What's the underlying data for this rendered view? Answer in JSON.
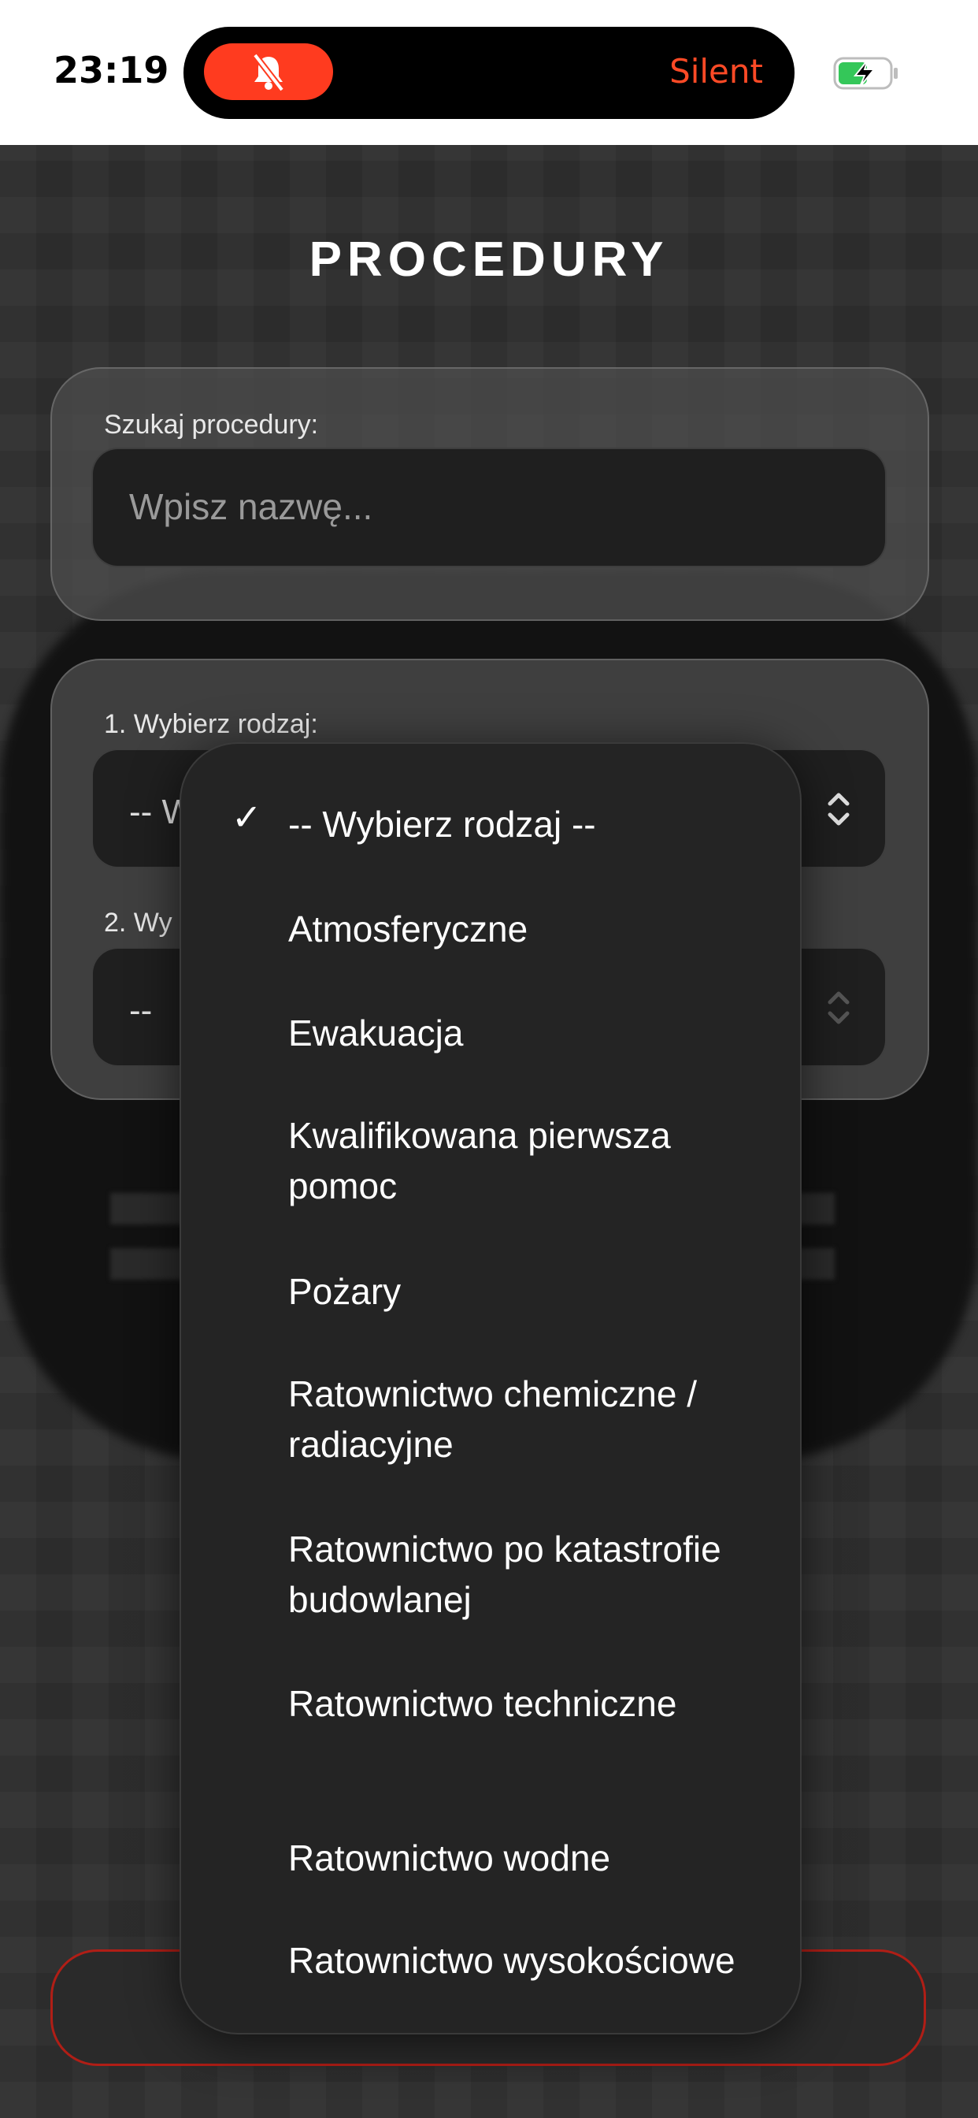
{
  "status_bar": {
    "time": "23:19",
    "silent_label": "Silent",
    "accent_color": "#ff3b1f",
    "battery_charging": true
  },
  "page": {
    "title": "PROCEDURY"
  },
  "search": {
    "label": "Szukaj procedury:",
    "placeholder": "Wpisz nazwę..."
  },
  "filters": {
    "type_label": "1. Wybierz rodzaj:",
    "type_value": "-- Wybierz rodzaj --",
    "second_label": "2. Wy",
    "second_value": "-- "
  },
  "dropdown": {
    "selected_index": 0,
    "options": [
      "-- Wybierz rodzaj --",
      "Atmosferyczne",
      "Ewakuacja",
      "Kwalifikowana pierwsza pomoc",
      "Pożary",
      "Ratownictwo chemiczne / radiacyjne",
      "Ratownictwo po katastrofie budowlanej",
      "Ratownictwo techniczne",
      "Ratownictwo wodne",
      "Ratownictwo wysokościowe"
    ]
  }
}
